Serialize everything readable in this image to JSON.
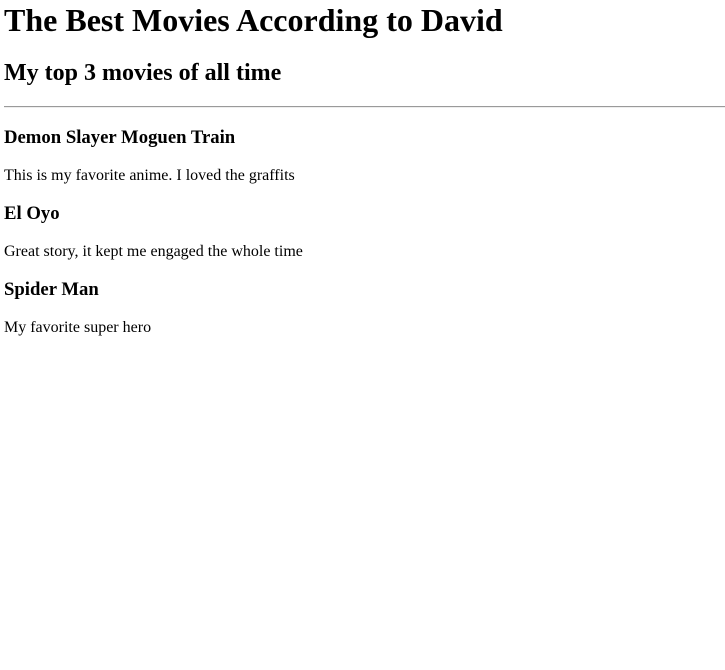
{
  "page": {
    "title": "The Best Movies According to David",
    "subtitle": "My top 3 movies of all time"
  },
  "movies": [
    {
      "title": "Demon Slayer Moguen Train",
      "review": "This is my favorite anime. I loved the graffits"
    },
    {
      "title": "El Oyo",
      "review": "Great story, it kept me engaged the whole time"
    },
    {
      "title": "Spider Man",
      "review": "My favorite super hero"
    }
  ]
}
